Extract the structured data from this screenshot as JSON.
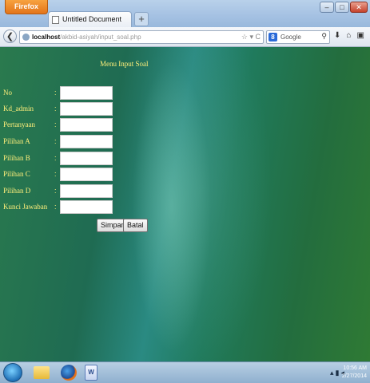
{
  "browser": {
    "app_button": "Firefox",
    "tab_title": "Untitled Document",
    "new_tab": "+",
    "url_host": "localhost",
    "url_path": "/akbid-asiyah/input_soal.php",
    "search_placeholder": "Google",
    "window_buttons": [
      "–",
      "□",
      "✕"
    ]
  },
  "page": {
    "title": "Menu Input Soal",
    "fields": [
      {
        "label": "No",
        "value": ""
      },
      {
        "label": "Kd_admin",
        "value": ""
      },
      {
        "label": "Pertanyaan",
        "value": ""
      },
      {
        "label": "Pilihan A",
        "value": ""
      },
      {
        "label": "Pilihan B",
        "value": ""
      },
      {
        "label": "Pilihan C",
        "value": ""
      },
      {
        "label": "Pilihan D",
        "value": ""
      },
      {
        "label": "Kunci Jawaban",
        "value": ""
      }
    ],
    "separator": ":",
    "buttons": {
      "save": "Simpan",
      "cancel": "Batal"
    }
  },
  "taskbar": {
    "time": "10:56 AM",
    "date": "2/27/2014"
  },
  "colors": {
    "label_text": "#ffef7a",
    "firefox_orange": "#e3741a"
  }
}
